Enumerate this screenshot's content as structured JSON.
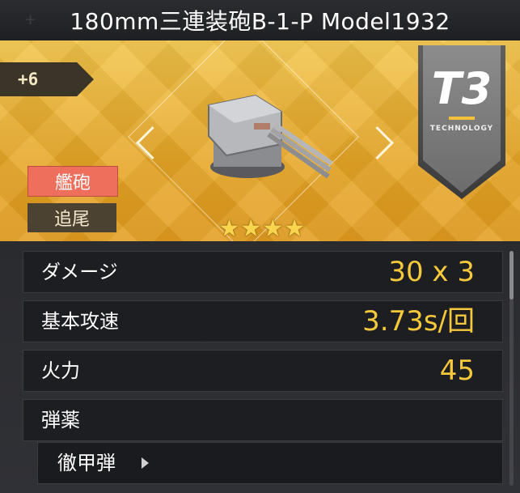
{
  "header": {
    "title": "180mm三連装砲B-1-P Model1932"
  },
  "banner": {
    "level": "+6",
    "tier": {
      "label": "T3",
      "subtitle": "TECHNOLOGY"
    },
    "tags": [
      {
        "label": "艦砲",
        "color": "#ee6f5c"
      },
      {
        "label": "追尾",
        "color": "#4c4232"
      }
    ],
    "rarity_stars": 4,
    "item_icon": "triple-gun-turret-icon"
  },
  "stats": [
    {
      "label": "ダメージ",
      "value": "30 x 3"
    },
    {
      "label": "基本攻速",
      "value": "3.73s/回"
    },
    {
      "label": "火力",
      "value": "45"
    },
    {
      "label": "弾薬",
      "value": ""
    }
  ],
  "ammo": {
    "label": "徹甲弾",
    "icon": "chevron-right-icon"
  },
  "colors": {
    "accent": "#f6c83c",
    "banner": "#e7a626",
    "panel": "#1d1e21"
  }
}
